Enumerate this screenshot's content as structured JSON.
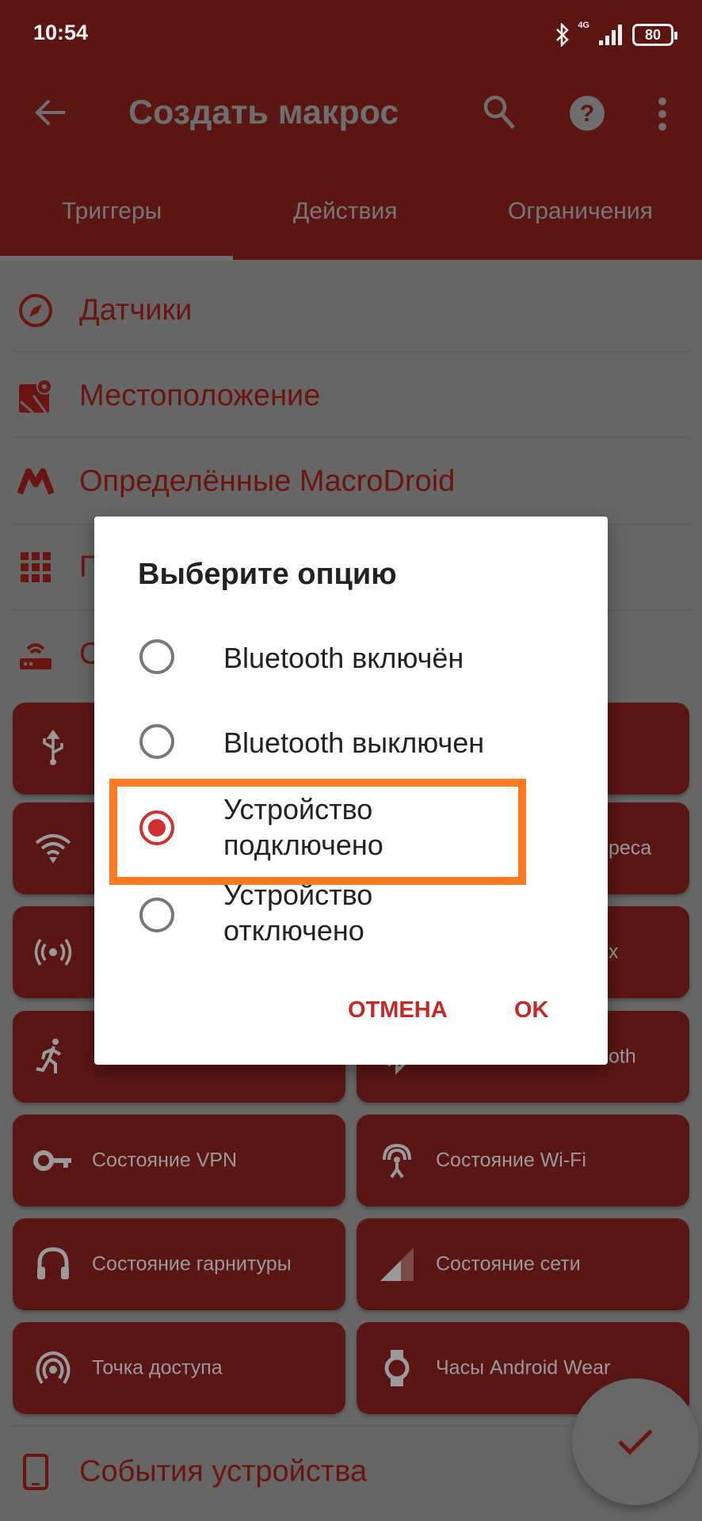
{
  "status_bar": {
    "time": "10:54",
    "network": "4G",
    "battery": "80"
  },
  "app_bar": {
    "title": "Создать макрос",
    "icons": [
      "arrow-back-icon",
      "search-icon",
      "help-icon",
      "more-vert-icon"
    ]
  },
  "tabs": [
    {
      "label": "Триггеры",
      "selected": true
    },
    {
      "label": "Действия",
      "selected": false
    },
    {
      "label": "Ограничения",
      "selected": false
    }
  ],
  "categories": [
    {
      "label": "Датчики",
      "icon": "compass-icon"
    },
    {
      "label": "Местоположение",
      "icon": "map-pin-icon"
    },
    {
      "label": "Определённые MacroDroid",
      "icon": "macrodroid-logo-icon"
    },
    {
      "label": "П",
      "icon": "grid-icon"
    },
    {
      "label": "С",
      "icon": "router-icon"
    }
  ],
  "cards": [
    {
      "label": "",
      "icon": "usb-icon"
    },
    {
      "label": "",
      "icon": ""
    },
    {
      "label": "",
      "icon": "wifi-icon"
    },
    {
      "label": "реса",
      "icon": ""
    },
    {
      "label": "",
      "icon": "broadcast-icon"
    },
    {
      "label": "х",
      "icon": ""
    },
    {
      "label": "",
      "icon": "run-icon"
    },
    {
      "label": "oth",
      "icon": "bluetooth-icon"
    },
    {
      "label": "Состояние VPN",
      "icon": "key-icon"
    },
    {
      "label": "Состояние Wi-Fi",
      "icon": "wifi-tower-icon"
    },
    {
      "label": "Состояние гарнитуры",
      "icon": "headset-icon"
    },
    {
      "label": "Состояние сети",
      "icon": "signal-icon"
    },
    {
      "label": "Точка доступа",
      "icon": "hotspot-icon"
    },
    {
      "label": "Часы Android Wear",
      "icon": "watch-icon"
    }
  ],
  "bottom_category": {
    "label": "События устройства",
    "icon": "phone-icon"
  },
  "dialog": {
    "title": "Выберите опцию",
    "options": [
      {
        "line1": "Bluetooth включён",
        "line2": "",
        "selected": false
      },
      {
        "line1": "Bluetooth выключен",
        "line2": "",
        "selected": false
      },
      {
        "line1": "Устройство",
        "line2": "подключено",
        "selected": true
      },
      {
        "line1": "Устройство",
        "line2": "отключено",
        "selected": false
      }
    ],
    "cancel": "ОТМЕНА",
    "ok": "OK"
  },
  "colors": {
    "primary_dimmed": "#5B1614",
    "accent": "#D32F2F",
    "highlight": "#FF7A22"
  }
}
